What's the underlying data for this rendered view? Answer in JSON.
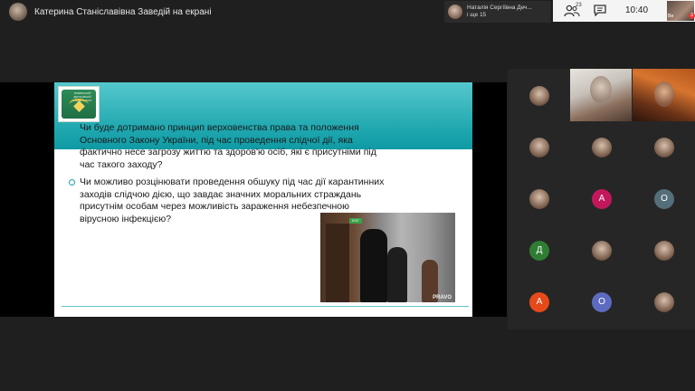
{
  "header": {
    "presenter_label": "Катерина Станіславівна Заведій на екрані",
    "notice_line1": "Наталія Сергіївна Деч...",
    "notice_line2": "і ще 15",
    "participants_count": "23",
    "time": "10:40",
    "self_label": "Ви",
    "rec_badge": "3"
  },
  "slide": {
    "logo_caption": "ЛЬВІВСЬКИЙ ДЕРЖАВНИЙ УНІВЕРСИТЕТ",
    "question1_lines": [
      "Чи буде дотримано принцип верховенства права та положення",
      "Основного Закону України, під час проведення слідчої дії, яка",
      "фактично несе загрозу життю та здоров'ю осіб, які є присутніми під",
      "час такого заходу?"
    ],
    "question2_lines": [
      "Чи можливо розцінювати проведення обшуку під час дії карантинних",
      "заходів слідчою дією, що завдає значних моральних страждань",
      "присутнім особам через можливість зараження небезпечною",
      "вірусною інфекцією?"
    ],
    "photo_sign": "EXIT",
    "photo_watermark": "PRAVO"
  },
  "participants": [
    {
      "kind": "photo",
      "letter": "",
      "color": ""
    },
    {
      "kind": "video"
    },
    {
      "kind": "video"
    },
    {
      "kind": "photo",
      "letter": "",
      "color": ""
    },
    {
      "kind": "photo",
      "letter": "",
      "color": ""
    },
    {
      "kind": "photo",
      "letter": "",
      "color": ""
    },
    {
      "kind": "photo",
      "letter": "",
      "color": ""
    },
    {
      "kind": "letter",
      "letter": "А",
      "color": "#c2185b"
    },
    {
      "kind": "letter",
      "letter": "О",
      "color": "#546e7a"
    },
    {
      "kind": "letter",
      "letter": "Д",
      "color": "#2e7d32"
    },
    {
      "kind": "photo",
      "letter": "",
      "color": ""
    },
    {
      "kind": "photo",
      "letter": "",
      "color": ""
    },
    {
      "kind": "letter",
      "letter": "А",
      "color": "#e64a19"
    },
    {
      "kind": "letter",
      "letter": "О",
      "color": "#5c6bc0"
    },
    {
      "kind": "photo",
      "letter": "",
      "color": ""
    }
  ]
}
